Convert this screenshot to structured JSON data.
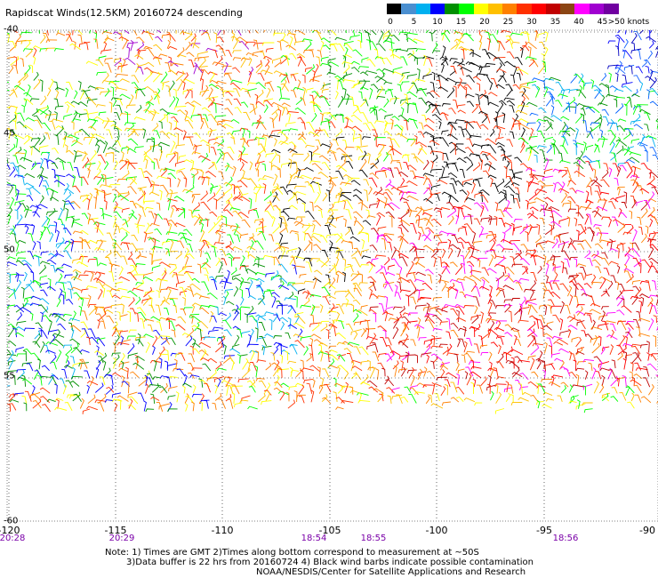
{
  "title": "Rapidscat Winds(12.5KM) 20160724 descending",
  "legend": {
    "ticks": [
      "0",
      "5",
      "10",
      "15",
      "20",
      "25",
      "30",
      "35",
      "40",
      "45",
      ">50 knots"
    ],
    "colors": [
      "#000000",
      "#4a8fd0",
      "#00b0f0",
      "#0000ff",
      "#009000",
      "#00ff00",
      "#ffff00",
      "#ffc000",
      "#ff8000",
      "#ff3000",
      "#ff0000",
      "#c00000",
      "#8b4513",
      "#ff00ff",
      "#a000d0",
      "#7000a0"
    ]
  },
  "map": {
    "lon_ticks": [
      "-120",
      "-115",
      "-110",
      "-105",
      "-100",
      "-95",
      "-90"
    ],
    "lat_ticks": [
      "-40",
      "-45",
      "-50",
      "-55",
      "-60"
    ],
    "lat_ticks_partial": [
      "45",
      "50",
      "55"
    ],
    "times": [
      "20:28",
      "20:29",
      "18:54",
      "18:55",
      "18:56"
    ]
  },
  "notes": {
    "line1": "Note: 1) Times are GMT 2)Times along bottom correspond to measurement at ~50S",
    "line2": "3)Data buffer is 22 hrs from 20160724 4) Black wind barbs indicate possible contamination",
    "line3": "NOAA/NESDIS/Center for Satellite Applications and Research"
  }
}
